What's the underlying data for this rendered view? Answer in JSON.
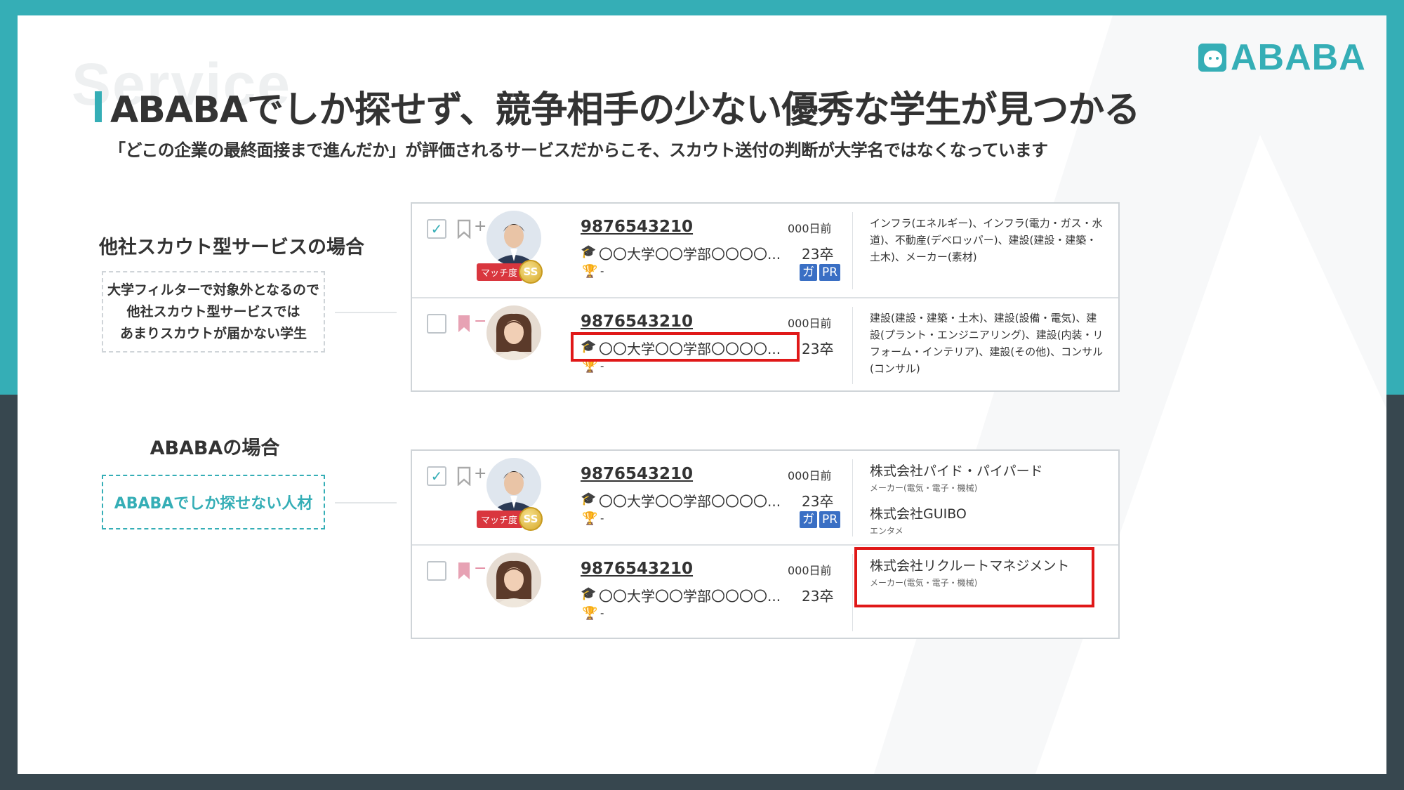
{
  "header": {
    "background_word": "Service",
    "logo_text": "ABABA",
    "title": "ABABAでしか探せず、競争相手の少ない優秀な学生が見つかる",
    "subtitle": "「どこの企業の最終面接まで進んだか」が評価されるサービスだからこそ、スカウト送付の判断が大学名ではなくなっています"
  },
  "colors": {
    "brand": "#35aeb6",
    "dark": "#37474f",
    "highlight": "#e01818",
    "badge": "#3a6fc4",
    "match": "#d9363e"
  },
  "case_other": {
    "label": "他社スカウト型サービスの場合",
    "note_lines": [
      "大学フィルターで対象外となるので",
      "他社スカウト型サービスでは",
      "あまりスカウトが届かない学生"
    ]
  },
  "case_ababa": {
    "label": "ABABAの場合",
    "note": "ABABAでしか探せない人材"
  },
  "panel_other": {
    "rows": [
      {
        "checked": true,
        "bookmark_sign": "+",
        "match_label": "マッチ度",
        "match_grade": "SS",
        "student_id": "9876543210",
        "university": "〇〇大学〇〇学部〇〇〇〇...",
        "trophy_value": "-",
        "days_ago": "000日前",
        "grad_year": "23卒",
        "badges": [
          "ガ",
          "PR"
        ],
        "industries": "インフラ(エネルギー)、インフラ(電力・ガス・水道)、不動産(デベロッパー)、建設(建設・建築・土木)、メーカー(素材)"
      },
      {
        "checked": false,
        "bookmark_sign": "−",
        "student_id": "9876543210",
        "university": "〇〇大学〇〇学部〇〇〇〇...",
        "trophy_value": "-",
        "days_ago": "000日前",
        "grad_year": "23卒",
        "industries": "建設(建設・建築・土木)、建設(設備・電気)、建設(プラント・エンジニアリング)、建設(内装・リフォーム・インテリア)、建設(その他)、コンサル(コンサル)"
      }
    ]
  },
  "panel_ababa": {
    "rows": [
      {
        "checked": true,
        "bookmark_sign": "+",
        "match_label": "マッチ度",
        "match_grade": "SS",
        "student_id": "9876543210",
        "university": "〇〇大学〇〇学部〇〇〇〇...",
        "trophy_value": "-",
        "days_ago": "000日前",
        "grad_year": "23卒",
        "badges": [
          "ガ",
          "PR"
        ],
        "companies": [
          {
            "name": "株式会社パイド・パイパード",
            "category": "メーカー(電気・電子・機械)"
          },
          {
            "name": "株式会社GUIBO",
            "category": "エンタメ"
          }
        ]
      },
      {
        "checked": false,
        "bookmark_sign": "−",
        "student_id": "9876543210",
        "university": "〇〇大学〇〇学部〇〇〇〇...",
        "trophy_value": "-",
        "days_ago": "000日前",
        "grad_year": "23卒",
        "companies": [
          {
            "name": "株式会社リクルートマネジメント",
            "category": "メーカー(電気・電子・機械)"
          }
        ]
      }
    ]
  }
}
